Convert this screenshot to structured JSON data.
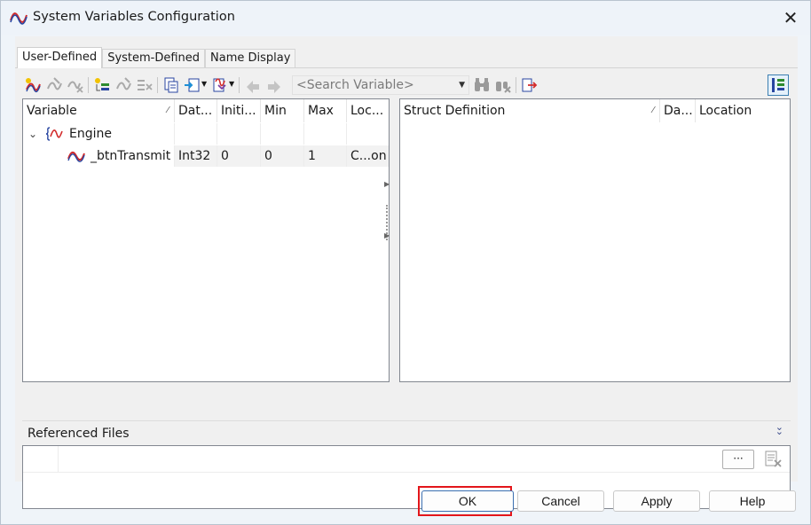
{
  "window": {
    "title": "System Variables Configuration",
    "close_label": "✕"
  },
  "tabs": [
    {
      "label": "User-Defined",
      "active": true
    },
    {
      "label": "System-Defined",
      "active": false
    },
    {
      "label": "Name Display",
      "active": false
    }
  ],
  "toolbar": {
    "search_placeholder": "<Search Variable>",
    "icons": [
      "new-variable-icon",
      "edit-variable-icon",
      "delete-variable-icon",
      "new-namespace-icon",
      "edit-namespace-icon",
      "delete-namespace-icon",
      "copy-icon",
      "paste-icon",
      "import-dropdown-icon",
      "move-up-icon",
      "move-down-icon",
      "search-binoculars-icon",
      "clear-search-icon",
      "export-icon",
      "layout-toggle-icon"
    ]
  },
  "variables_table": {
    "columns": [
      "Variable",
      "Dat...",
      "Initi...",
      "Min",
      "Max",
      "Loc..."
    ],
    "sort_indicator": "⁄",
    "rows": [
      {
        "level": 0,
        "name": "Engine",
        "type": "namespace",
        "expanded": true,
        "datatype": "",
        "initial": "",
        "min": "",
        "max": "",
        "location": ""
      },
      {
        "level": 1,
        "name": "_btnTransmit",
        "type": "variable",
        "datatype": "Int32",
        "initial": "0",
        "min": "0",
        "max": "1",
        "location": "C...on"
      }
    ]
  },
  "struct_table": {
    "columns": [
      "Struct Definition",
      "Da...",
      "Location"
    ],
    "sort_indicator": "⁄"
  },
  "referenced_files": {
    "label": "Referenced Files",
    "collapse_glyph": "⌄⌄",
    "browse_label": "···"
  },
  "buttons": {
    "ok": "OK",
    "cancel": "Cancel",
    "apply": "Apply",
    "help": "Help"
  }
}
